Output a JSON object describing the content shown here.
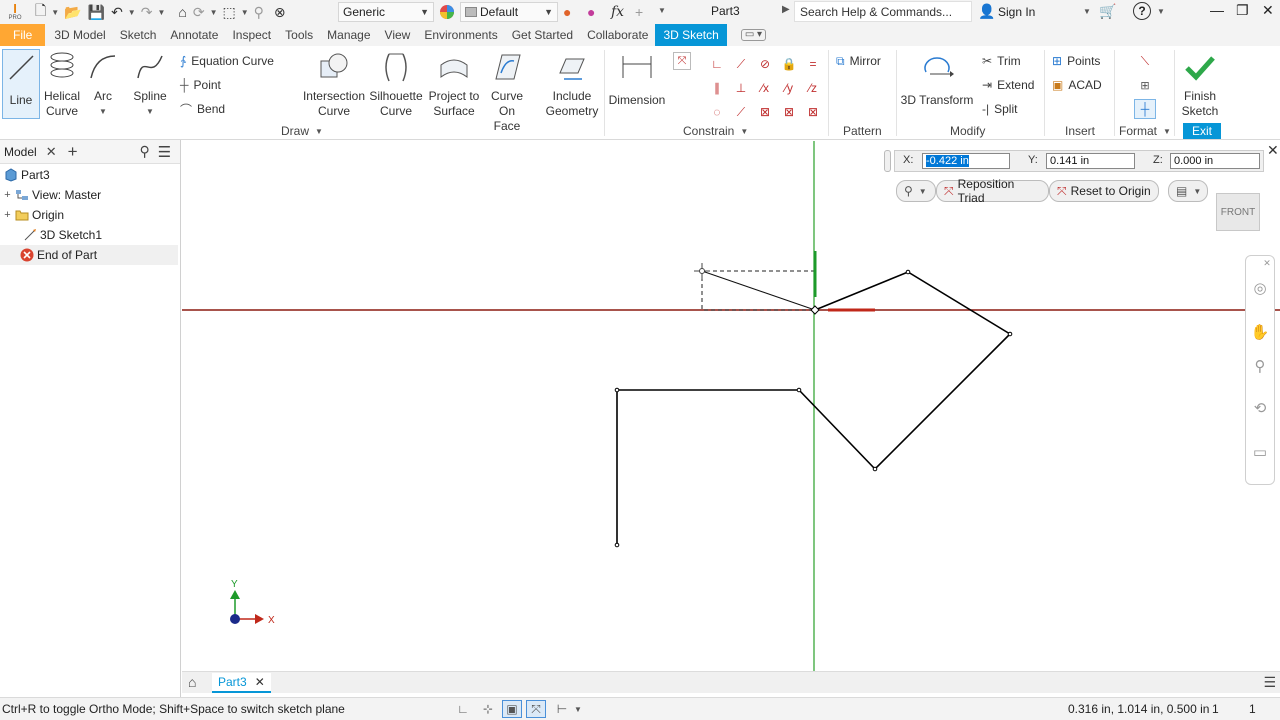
{
  "quick_access": {
    "appearance_combo": "Generic",
    "design_view_combo": "Default",
    "document_title": "Part3",
    "search_placeholder": "Search Help & Commands...",
    "sign_in": "Sign In",
    "app_badge": "PRO"
  },
  "tabs": [
    {
      "label": "File"
    },
    {
      "label": "3D Model"
    },
    {
      "label": "Sketch"
    },
    {
      "label": "Annotate"
    },
    {
      "label": "Inspect"
    },
    {
      "label": "Tools"
    },
    {
      "label": "Manage"
    },
    {
      "label": "View"
    },
    {
      "label": "Environments"
    },
    {
      "label": "Get Started"
    },
    {
      "label": "Collaborate"
    },
    {
      "label": "3D Sketch"
    }
  ],
  "ribbon": {
    "draw": {
      "line": "Line",
      "helical_l1": "Helical",
      "helical_l2": "Curve",
      "arc": "Arc",
      "spline": "Spline",
      "equation_curve": "Equation Curve",
      "point": "Point",
      "bend": "Bend",
      "intersection_l1": "Intersection",
      "intersection_l2": "Curve",
      "silhouette_l1": "Silhouette",
      "silhouette_l2": "Curve",
      "project_l1": "Project to",
      "project_l2": "Surface",
      "curve_face_l1": "Curve",
      "curve_face_l2": "On Face",
      "include_l1": "Include",
      "include_l2": "Geometry",
      "panel_label": "Draw"
    },
    "constrain": {
      "dimension": "Dimension",
      "panel_label": "Constrain"
    },
    "pattern": {
      "mirror": "Mirror",
      "panel_label": "Pattern"
    },
    "modify": {
      "transform": "3D Transform",
      "trim": "Trim",
      "extend": "Extend",
      "split": "Split",
      "panel_label": "Modify"
    },
    "insert": {
      "points": "Points",
      "acad": "ACAD",
      "panel_label": "Insert"
    },
    "format": {
      "panel_label": "Format"
    },
    "exit": {
      "finish_l1": "Finish",
      "finish_l2": "Sketch",
      "panel_label": "Exit"
    }
  },
  "browser": {
    "tab_label": "Model",
    "items": [
      {
        "label": "Part3"
      },
      {
        "label": "View: Master"
      },
      {
        "label": "Origin"
      },
      {
        "label": "3D Sketch1"
      },
      {
        "label": "End of Part"
      }
    ]
  },
  "graphics": {
    "input": {
      "x_label": "X:",
      "x_value": "-0.422 in",
      "y_label": "Y:",
      "y_value": "0.141 in",
      "z_label": "Z:",
      "z_value": "0.000 in"
    },
    "reposition_triad": "Reposition Triad",
    "reset_to_origin": "Reset to Origin",
    "viewcube_face": "FRONT",
    "triad_y": "Y",
    "triad_x": "X",
    "colors": {
      "x_axis": "#8b1a10",
      "y_axis": "#2aa02a",
      "sketch": "#000000"
    }
  },
  "doc_tabs": [
    {
      "label": "Part3"
    }
  ],
  "status": {
    "message": "Ctrl+R to toggle Ortho Mode; Shift+Space to switch sketch plane",
    "coordinates": "0.316 in, 1.014 in, 0.500 in",
    "count1": "1",
    "count2": "1"
  }
}
